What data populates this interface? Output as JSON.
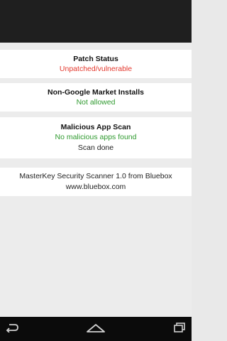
{
  "cards": [
    {
      "title": "Patch Status",
      "lines": [
        "Unpatched/vulnerable"
      ]
    },
    {
      "title": "Non-Google Market Installs",
      "lines": [
        "Not allowed"
      ]
    },
    {
      "title": "Malicious App Scan",
      "lines": [
        "No malicious apps found",
        "Scan done"
      ]
    }
  ],
  "about": {
    "line1": "MasterKey Security Scanner 1.0 from Bluebox",
    "line2": "www.bluebox.com"
  },
  "colors": {
    "vulnerable": "#e3372c",
    "ok": "#2f9a2f"
  },
  "nav": {
    "icons": [
      "back-icon",
      "home-icon",
      "recent-apps-icon"
    ]
  }
}
